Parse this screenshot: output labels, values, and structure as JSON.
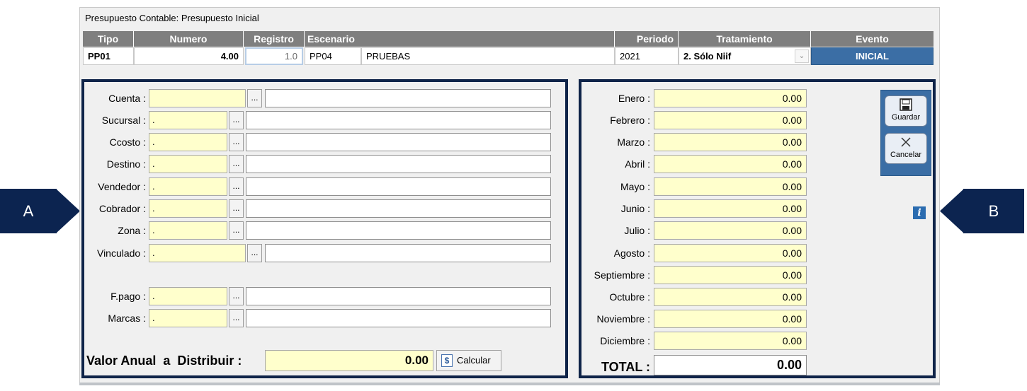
{
  "window_title": "Presupuesto Contable: Presupuesto Inicial",
  "header": {
    "columns": [
      "Tipo",
      "Numero",
      "Registro",
      "Escenario",
      "Periodo",
      "Tratamiento",
      "Evento"
    ],
    "values": {
      "tipo": "PP01",
      "numero": "4.00",
      "registro": "1.0",
      "escenario_code": "PP04",
      "escenario_name": "PRUEBAS",
      "periodo": "2021",
      "tratamiento": "2. Sólo Niif",
      "evento": "INICIAL"
    }
  },
  "left_panel": {
    "fields": [
      {
        "label": "Cuenta :",
        "code": ""
      },
      {
        "label": "Sucursal :",
        "code": "."
      },
      {
        "label": "Ccosto :",
        "code": "."
      },
      {
        "label": "Destino :",
        "code": "."
      },
      {
        "label": "Vendedor :",
        "code": "."
      },
      {
        "label": "Cobrador :",
        "code": "."
      },
      {
        "label": "Zona :",
        "code": "."
      },
      {
        "label": "Vinculado :",
        "code": "."
      },
      {
        "label": "F.pago :",
        "code": "."
      },
      {
        "label": "Marcas :",
        "code": "."
      }
    ],
    "ellipsis": "...",
    "valor_label": "Valor Anual  a  Distribuir :",
    "valor_value": "0.00",
    "calcular_label": "Calcular",
    "calcular_icon": "$"
  },
  "right_panel": {
    "months": [
      {
        "label": "Enero :",
        "value": "0.00"
      },
      {
        "label": "Febrero :",
        "value": "0.00"
      },
      {
        "label": "Marzo :",
        "value": "0.00"
      },
      {
        "label": "Abril :",
        "value": "0.00"
      },
      {
        "label": "Mayo :",
        "value": "0.00"
      },
      {
        "label": "Junio :",
        "value": "0.00"
      },
      {
        "label": "Julio :",
        "value": "0.00"
      },
      {
        "label": "Agosto :",
        "value": "0.00"
      },
      {
        "label": "Septiembre :",
        "value": "0.00"
      },
      {
        "label": "Octubre :",
        "value": "0.00"
      },
      {
        "label": "Noviembre :",
        "value": "0.00"
      },
      {
        "label": "Diciembre :",
        "value": "0.00"
      }
    ],
    "total_label": "TOTAL :",
    "total_value": "0.00"
  },
  "toolbar": {
    "guardar_label": "Guardar",
    "cancelar_label": "Cancelar",
    "info_glyph": "i"
  },
  "callouts": {
    "a": "A",
    "b": "B"
  },
  "colors": {
    "frame": "#0f2449",
    "evento": "#3b6ea5",
    "input_yellow": "#ffffcc",
    "header_gray": "#7f7f7f"
  }
}
